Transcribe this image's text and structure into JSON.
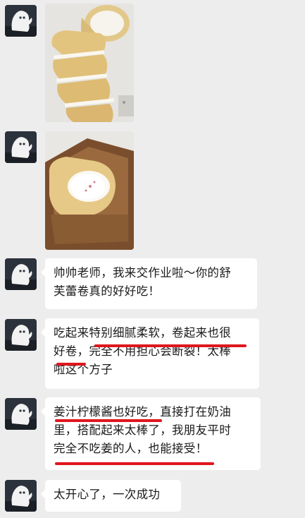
{
  "chat": {
    "messages": [
      {
        "type": "image",
        "alt": "swiss roll slices"
      },
      {
        "type": "image",
        "alt": "swiss roll in box"
      },
      {
        "type": "text",
        "text": "帅帅老师，我来交作业啦～你的舒\n芙蕾卷真的好好吃！"
      },
      {
        "type": "text",
        "text": "吃起来特别细腻柔软，卷起来也很\n好卷，完全不用担心会断裂！太棒\n啦这个方子"
      },
      {
        "type": "text",
        "text": "姜汁柠檬酱也好吃，直接打在奶油\n里，搭配起来太棒了，我朋友平时\n完全不吃姜的人，也能接受！"
      },
      {
        "type": "text",
        "text": "太开心了，一次成功"
      }
    ]
  },
  "colors": {
    "background": "#ededed",
    "bubble": "#ffffff",
    "highlight_underline": "#e0161e"
  },
  "icons": {
    "avatar": "white-ghost-avatar-icon"
  }
}
